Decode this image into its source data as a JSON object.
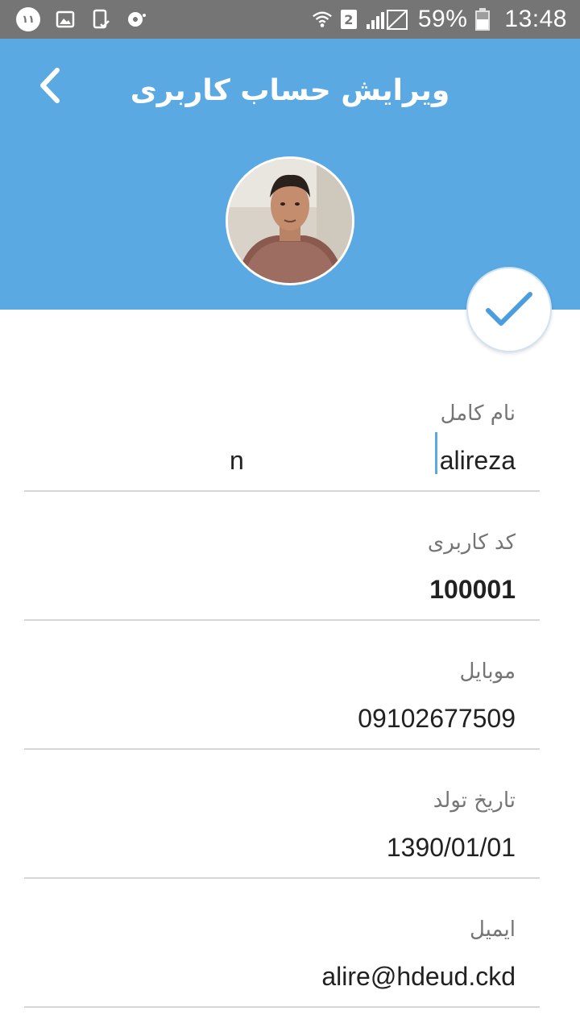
{
  "status_bar": {
    "notification_count": "۱۱",
    "sim_slot": "2",
    "battery": "59%",
    "battery_level": 0.59,
    "time": "13:48"
  },
  "header": {
    "title": "ویرایش حساب کاربری",
    "back_icon": "chevron-left-icon",
    "avatar": "profile-photo"
  },
  "fab": {
    "icon": "check-icon"
  },
  "form": {
    "full_name": {
      "label": "نام کامل",
      "value": "alireza",
      "trailing_char": "n"
    },
    "user_code": {
      "label": "کد کاربری",
      "value": "100001"
    },
    "mobile": {
      "label": "موبایل",
      "value": "09102677509"
    },
    "birth_date": {
      "label": "تاریخ تولد",
      "value": "1390/01/01"
    },
    "email": {
      "label": "ایمیل",
      "value": "alire@hdeud.ckd"
    }
  },
  "colors": {
    "accent": "#5aa9e2",
    "status_bar": "#757575",
    "divider": "#d6d6d6",
    "label": "#757575",
    "text": "#212121"
  }
}
